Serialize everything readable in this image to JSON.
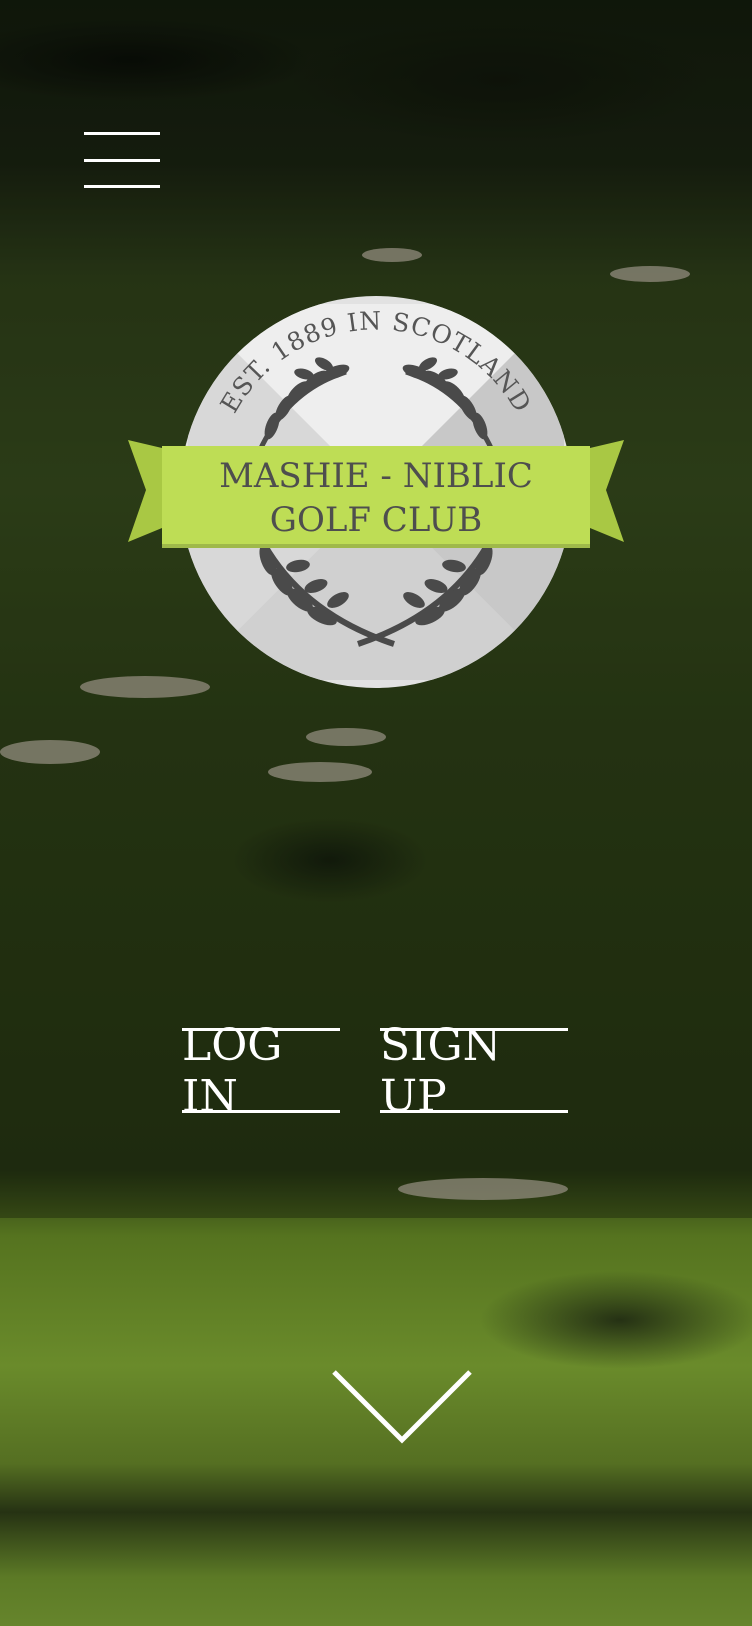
{
  "header": {
    "menu_icon": "hamburger-menu-icon"
  },
  "logo": {
    "established_text": "EST. 1889 IN SCOTLAND",
    "club_name_line1": "MASHIE - NIBLIC",
    "club_name_line2": "GOLF CLUB",
    "ribbon_color": "#bedd55",
    "seal_color": "#e2e2e2",
    "laurel_color": "#4a4a4a"
  },
  "auth": {
    "login_label": "LOG IN",
    "signup_label": "SIGN UP"
  },
  "scroll": {
    "icon": "chevron-down-icon"
  }
}
